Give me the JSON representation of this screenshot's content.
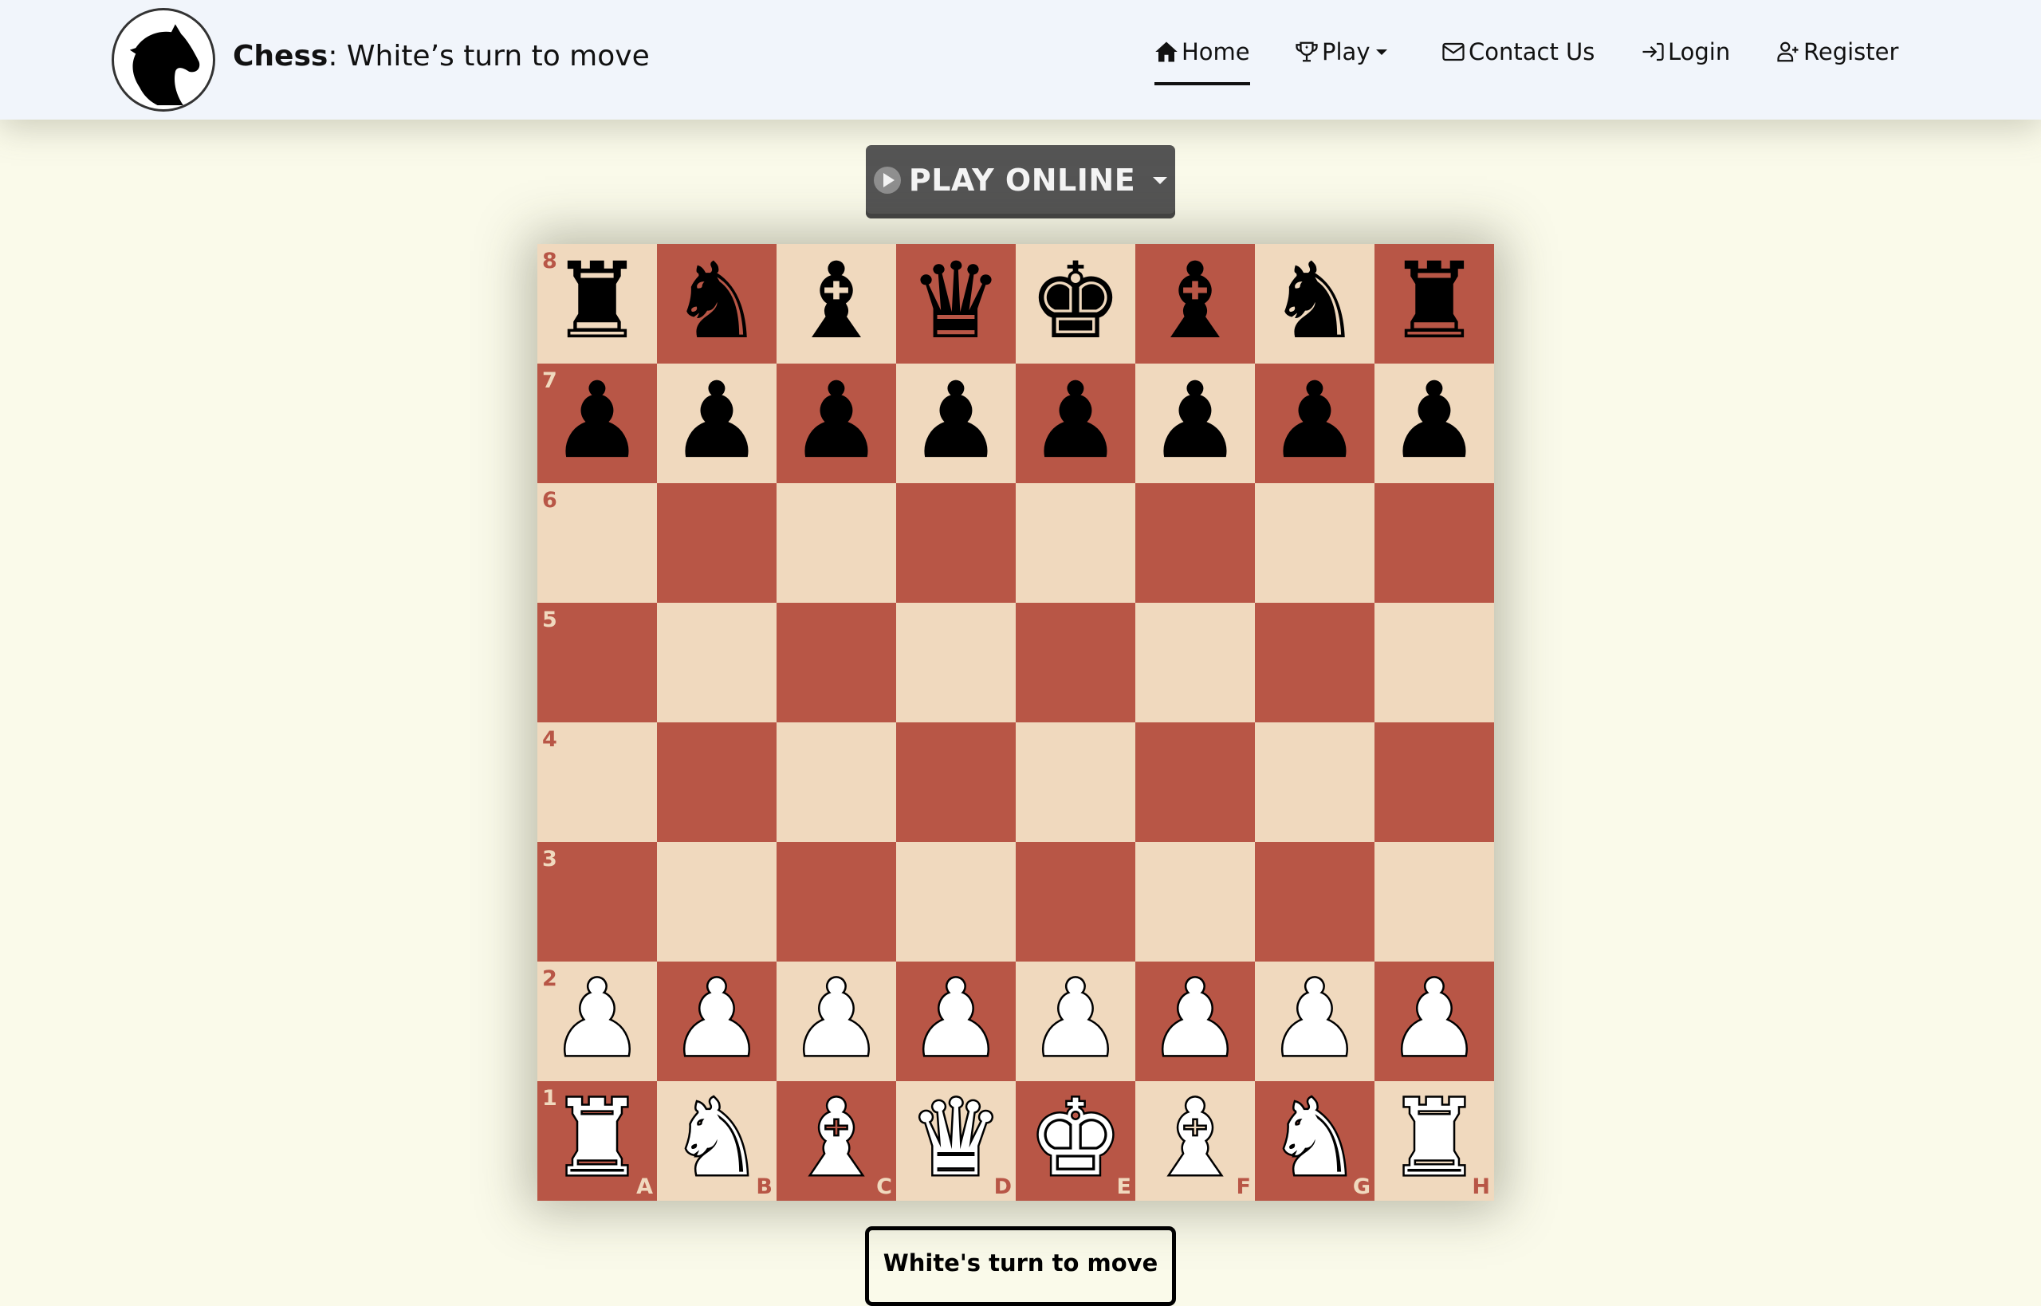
{
  "header": {
    "brand_bold": "Chess",
    "brand_rest": ": White’s turn to move",
    "nav": [
      {
        "label": "Home",
        "icon": "home-icon",
        "active": true
      },
      {
        "label": "Play",
        "icon": "trophy-icon",
        "dropdown": true
      },
      {
        "label": "Contact Us",
        "icon": "envelope-icon"
      },
      {
        "label": "Login",
        "icon": "login-icon"
      },
      {
        "label": "Register",
        "icon": "user-plus-icon"
      }
    ]
  },
  "play_online": {
    "label": "PLAY ONLINE",
    "icon": "play-circle-icon"
  },
  "board": {
    "ranks": [
      "8",
      "7",
      "6",
      "5",
      "4",
      "3",
      "2",
      "1"
    ],
    "files": [
      "A",
      "B",
      "C",
      "D",
      "E",
      "F",
      "G",
      "H"
    ],
    "colors": {
      "light": "#F0D9BE",
      "dark": "#B85646"
    },
    "position": [
      [
        "br",
        "bn",
        "bb",
        "bq",
        "bk",
        "bb",
        "bn",
        "br"
      ],
      [
        "bp",
        "bp",
        "bp",
        "bp",
        "bp",
        "bp",
        "bp",
        "bp"
      ],
      [
        "",
        "",
        "",
        "",
        "",
        "",
        "",
        ""
      ],
      [
        "",
        "",
        "",
        "",
        "",
        "",
        "",
        ""
      ],
      [
        "",
        "",
        "",
        "",
        "",
        "",
        "",
        ""
      ],
      [
        "",
        "",
        "",
        "",
        "",
        "",
        "",
        ""
      ],
      [
        "wp",
        "wp",
        "wp",
        "wp",
        "wp",
        "wp",
        "wp",
        "wp"
      ],
      [
        "wr",
        "wn",
        "wb",
        "wq",
        "wk",
        "wb",
        "wn",
        "wr"
      ]
    ]
  },
  "status": {
    "text": "White's turn to move"
  }
}
